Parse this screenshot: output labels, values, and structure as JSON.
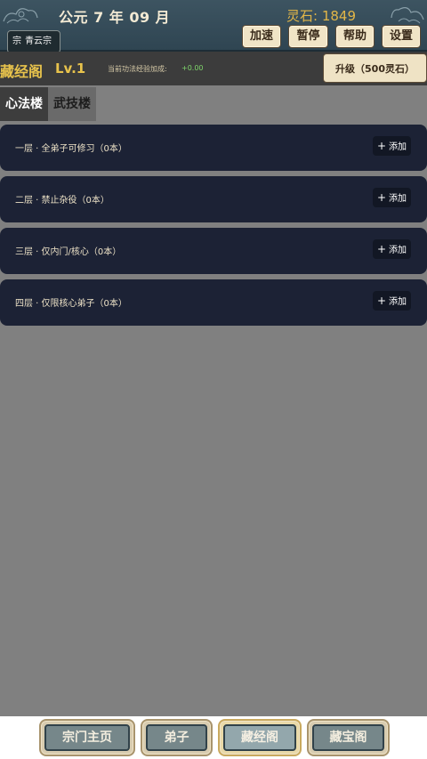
{
  "header": {
    "date": "公元 7 年 09 月",
    "spirit_stones": "灵石: 1849",
    "sect_prefix": "宗",
    "sect_name": "青云宗",
    "buttons": {
      "speed": "加速",
      "pause": "暂停",
      "help": "帮助",
      "settings": "设置"
    }
  },
  "pavilion": {
    "title": "藏经阁",
    "level": "Lv.1",
    "bonus_label": "当前功法经验加成:",
    "bonus_value": "+0.00",
    "upgrade_label": "升级（500灵石）"
  },
  "tabs": [
    {
      "label": "心法楼",
      "active": true
    },
    {
      "label": "武技楼",
      "active": false
    }
  ],
  "floors": [
    {
      "label": "一层 · 全弟子可修习（0本）",
      "add": "添加"
    },
    {
      "label": "二层 · 禁止杂役（0本）",
      "add": "添加"
    },
    {
      "label": "三层 · 仅内门/核心（0本）",
      "add": "添加"
    },
    {
      "label": "四层 · 仅限核心弟子（0本）",
      "add": "添加"
    }
  ],
  "bottom_nav": [
    {
      "label": "宗门主页"
    },
    {
      "label": "弟子"
    },
    {
      "label": "藏经阁",
      "active": true
    },
    {
      "label": "藏宝阁"
    }
  ],
  "colors": {
    "header_bg": "#3d5461",
    "gold_text": "#e8c34c",
    "floor_bg": "#1c2235",
    "content_bg": "#808080",
    "bonus_green": "#7fd66b"
  },
  "icons": [
    "cloud-icon",
    "plus-icon"
  ]
}
